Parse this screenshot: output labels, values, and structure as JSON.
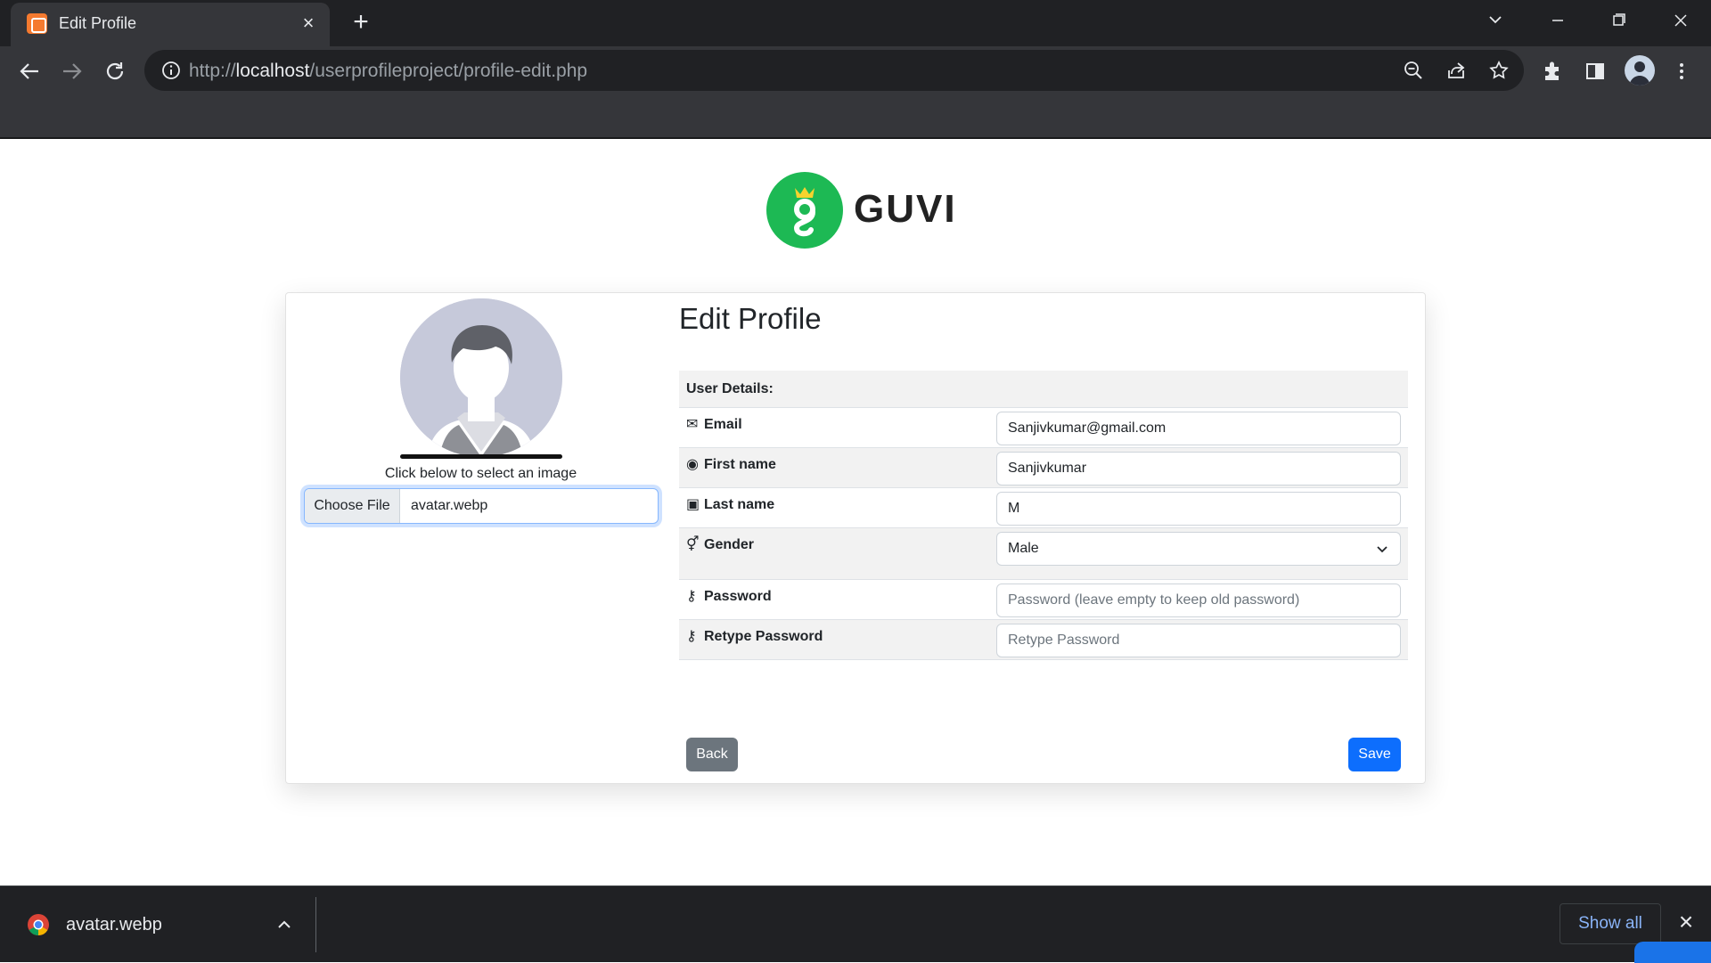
{
  "browser": {
    "tab_title": "Edit Profile",
    "url_prefix": "http://",
    "url_host": "localhost",
    "url_path": "/userprofileproject/profile-edit.php"
  },
  "header": {
    "logo_text": "GUVI"
  },
  "profile_image": {
    "hint": "Click below to select an image",
    "choose_file_label": "Choose File",
    "file_name": "avatar.webp"
  },
  "form": {
    "title": "Edit Profile",
    "section_label": "User Details:",
    "fields": {
      "email": {
        "label": "Email",
        "value": "Sanjivkumar@gmail.com"
      },
      "first_name": {
        "label": "First name",
        "value": "Sanjivkumar"
      },
      "last_name": {
        "label": "Last name",
        "value": "M"
      },
      "gender": {
        "label": "Gender",
        "value": "Male"
      },
      "password": {
        "label": "Password",
        "placeholder": "Password (leave empty to keep old password)"
      },
      "retype_password": {
        "label": "Retype Password",
        "placeholder": "Retype Password"
      }
    },
    "back_label": "Back",
    "save_label": "Save"
  },
  "downloads": {
    "file_name": "avatar.webp",
    "show_all_label": "Show all"
  },
  "colors": {
    "brand_green": "#1db954",
    "primary": "#0d6efd",
    "secondary": "#6c757d"
  }
}
